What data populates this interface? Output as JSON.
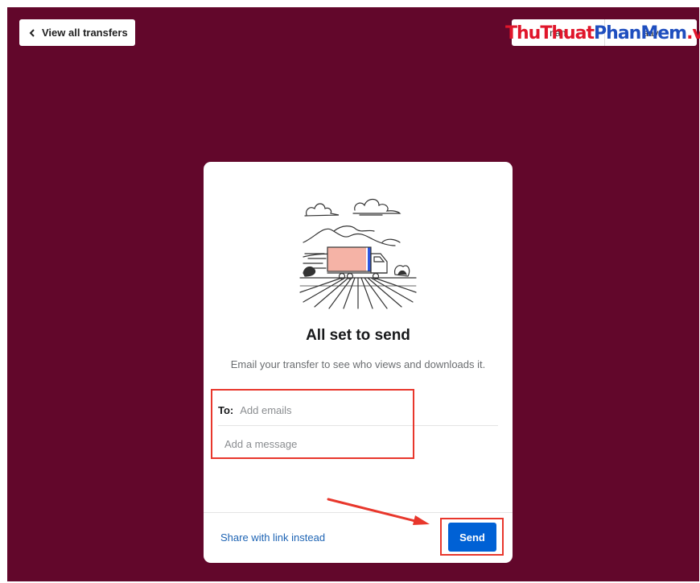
{
  "nav": {
    "back_label": "View all transfers",
    "top_right": [
      "nan",
      "aav"
    ]
  },
  "watermark": {
    "part1": "ThuThuat",
    "part2": "PhanMem",
    "part3": ".vn"
  },
  "card": {
    "title": "All set to send",
    "subtitle": "Email your transfer to see who views and downloads it.",
    "to_label": "To:",
    "to_placeholder": "Add emails",
    "message_placeholder": "Add a message",
    "share_link": "Share with link instead",
    "send_label": "Send"
  },
  "colors": {
    "background": "#62072b",
    "accent": "#0061d5",
    "highlight": "#e8372c"
  }
}
